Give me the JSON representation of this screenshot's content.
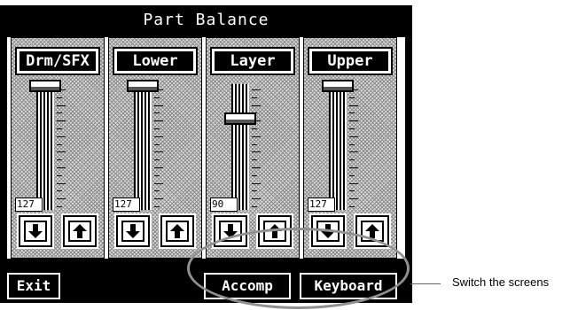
{
  "title": "Part Balance",
  "parts": [
    {
      "label": "Drm/SFX",
      "value": "127",
      "level": 127
    },
    {
      "label": "Lower",
      "value": "127",
      "level": 127
    },
    {
      "label": "Layer",
      "value": "90",
      "level": 90
    },
    {
      "label": "Upper",
      "value": "127",
      "level": 127
    }
  ],
  "level_max": 127,
  "buttons": {
    "exit": "Exit",
    "accomp": "Accomp",
    "keyboard": "Keyboard"
  },
  "caption": "Switch the screens",
  "icons": {
    "down": "down-arrow-icon",
    "up": "up-arrow-icon"
  }
}
